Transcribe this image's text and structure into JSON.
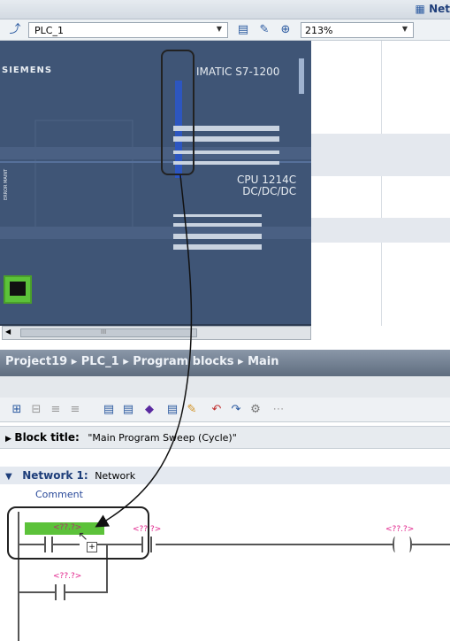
{
  "top_tab": {
    "label": "Net"
  },
  "device_toolbar": {
    "plc_select": "PLC_1",
    "zoom_select": "213%"
  },
  "device_view": {
    "brand": "SIEMENS",
    "model": "IMATIC S7-1200",
    "cpu_line1": "CPU 1214C",
    "cpu_line2": "DC/DC/DC",
    "error_label": "ERROR MAINT"
  },
  "scroll": {
    "thumb_label": "III"
  },
  "breadcrumb": [
    "Project19",
    "PLC_1",
    "Program blocks",
    "Main"
  ],
  "block": {
    "title_label": "Block title:",
    "title_value": "\"Main Program Sweep (Cycle)\""
  },
  "network": {
    "label": "Network 1:",
    "name": "Network",
    "comment": "Comment"
  },
  "ladder": {
    "tag_main": "<??.?>",
    "tag_top": "<??.?>",
    "tag_coil": "<??.?>",
    "tag_branch": "<??.?>"
  },
  "colors": {
    "device_bg": "#3f5576",
    "accent_green": "#5cc23a",
    "tag_pink": "#e0208a",
    "header_blue": "#1e3e7a"
  }
}
